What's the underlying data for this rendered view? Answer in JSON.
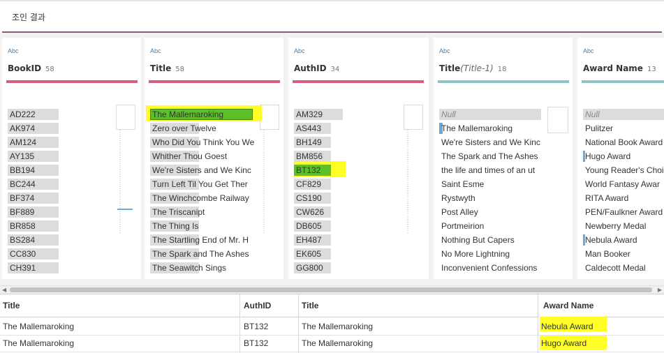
{
  "header": {
    "title": "조인 결과"
  },
  "colors": {
    "accent_bar": "#8a5a7c",
    "pink_bar": "#d4607c",
    "teal_bar": "#8ec4c8",
    "highlight": "#ffff00",
    "selected_green": "#5cbf2a"
  },
  "cards": [
    {
      "type_label": "Abc",
      "name": "BookID",
      "alias": "",
      "count": "58",
      "bar_color": "pink",
      "values": [
        "AD222",
        "AK974",
        "AM124",
        "AY135",
        "BB194",
        "BC244",
        "BF374",
        "BF889",
        "BR858",
        "BS284",
        "CC830",
        "CH391"
      ]
    },
    {
      "type_label": "Abc",
      "name": "Title",
      "alias": "",
      "count": "58",
      "bar_color": "pink",
      "values": [
        "The Mallemaroking",
        "Zero over Twelve",
        "Who Did You Think You We",
        "Whither Thou Goest",
        "We're Sisters and We Kinc",
        "Turn Left Til You Get Ther",
        "The Winchcombe Railway",
        "The Triscanipt",
        "The Thing Is",
        "The Startling End of Mr. H",
        "The Spark and The Ashes",
        "The Seawitch Sings"
      ],
      "selected_index": 0
    },
    {
      "type_label": "Abc",
      "name": "AuthID",
      "alias": "",
      "count": "34",
      "bar_color": "pink",
      "values": [
        "AM329",
        "AS443",
        "BH149",
        "BM856",
        "BT132",
        "CF829",
        "CS190",
        "CW626",
        "DB605",
        "EH487",
        "EK605",
        "GG800"
      ],
      "highlighted_index": 4
    },
    {
      "type_label": "Abc",
      "name": "Title",
      "alias": "(Title-1)",
      "count": "18",
      "bar_color": "teal",
      "values": [
        "Null",
        "The Mallemaroking",
        "We're Sisters and We Kinc",
        "The Spark and The Ashes",
        "the life and times of an ut",
        "Saint Esme",
        "Rystwyth",
        "Post Alley",
        "Portmeirion",
        "Nothing But Capers",
        "No More Lightning",
        "Inconvenient Confessions"
      ]
    },
    {
      "type_label": "Abc",
      "name": "Award Name",
      "alias": "",
      "count": "13",
      "bar_color": "teal",
      "values": [
        "Null",
        "Pulitzer",
        "National Book Award",
        "Hugo Award",
        "Young Reader's Choi",
        "World Fantasy Awar",
        "RITA Award",
        "PEN/Faulkner Award",
        "Newberry Medal",
        "Nebula Award",
        "Man Booker",
        "Caldecott Medal"
      ]
    }
  ],
  "result_table": {
    "columns": [
      "Title",
      "AuthID",
      "Title",
      "Award Name"
    ],
    "rows": [
      [
        "The Mallemaroking",
        "BT132",
        "The Mallemaroking",
        "Nebula Award"
      ],
      [
        "The Mallemaroking",
        "BT132",
        "The Mallemaroking",
        "Hugo Award"
      ]
    ]
  },
  "scrollbar": {
    "left_arrow": "◀",
    "right_arrow": "▶"
  }
}
